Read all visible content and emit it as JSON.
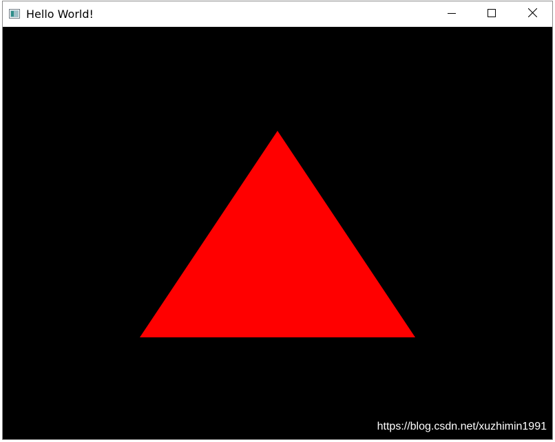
{
  "window": {
    "title": "Hello World!",
    "icon": "app-window-icon",
    "controls": {
      "minimize": "minimize-icon",
      "maximize": "maximize-icon",
      "close": "close-icon"
    }
  },
  "scene": {
    "background_color": "#000000",
    "shape": "triangle",
    "fill_color": "#ff0000"
  },
  "watermark": {
    "text": "https://blog.csdn.net/xuzhimin1991"
  }
}
